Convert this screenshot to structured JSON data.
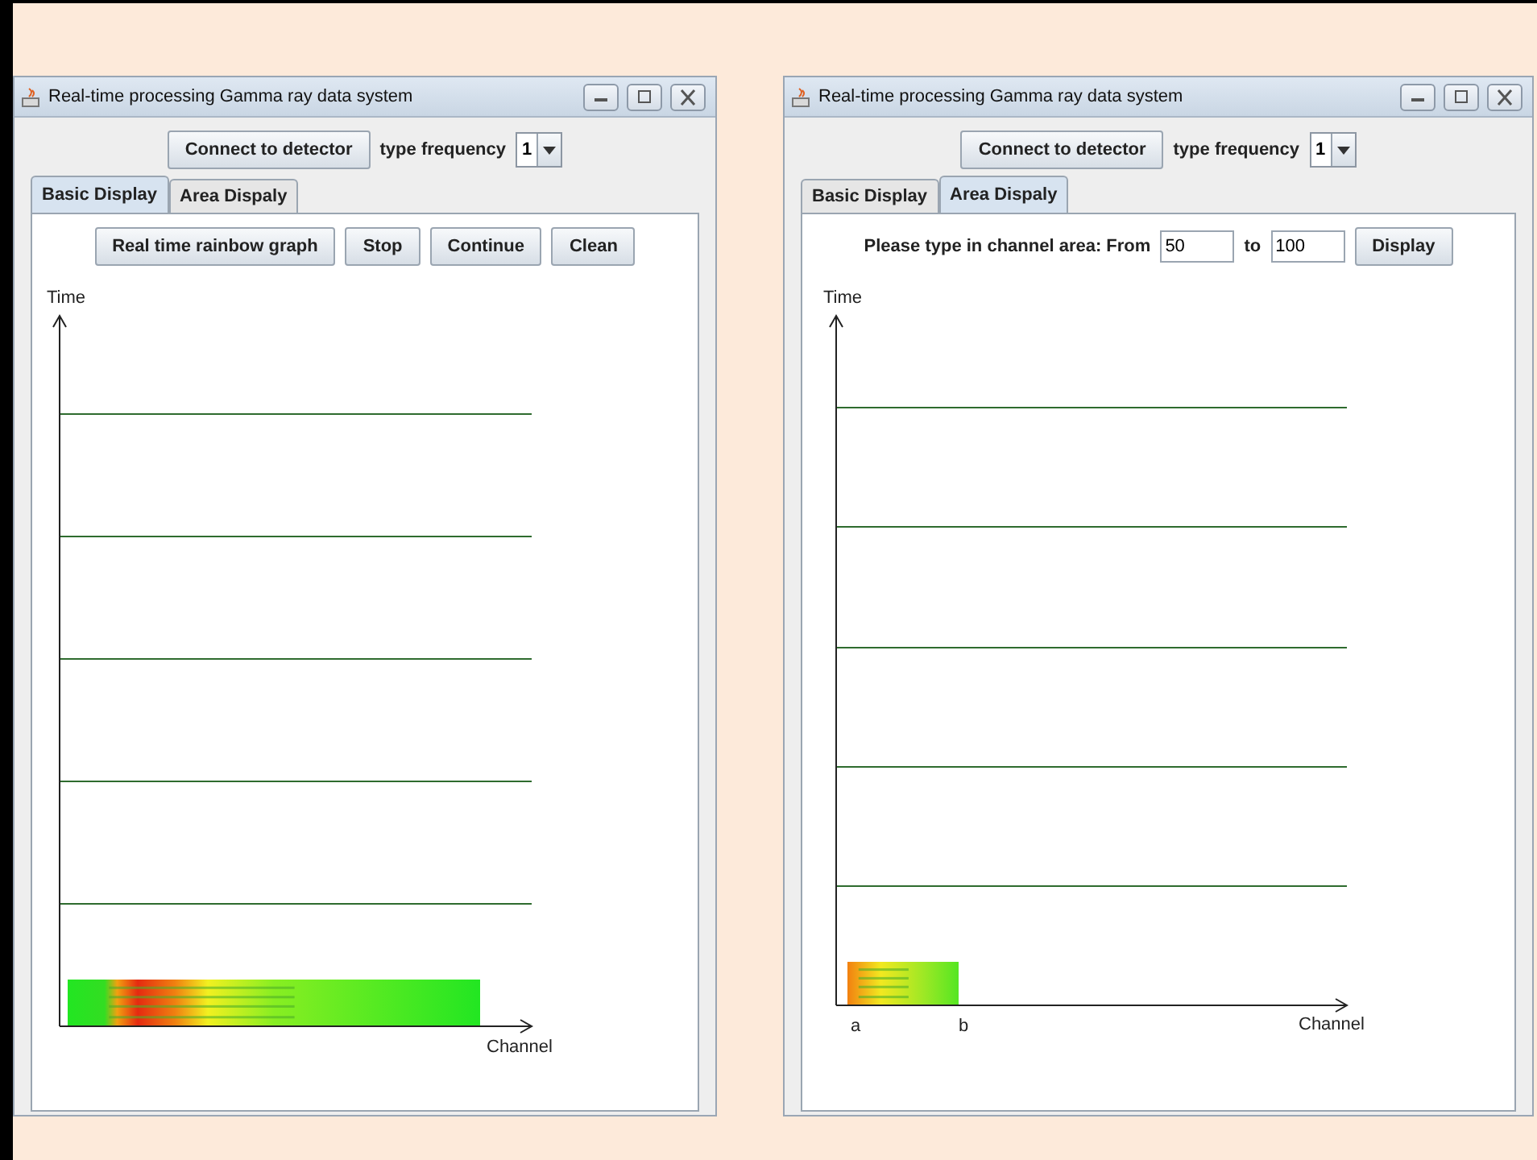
{
  "windows": [
    {
      "title": "Real-time processing Gamma ray data system",
      "connect_button": "Connect to detector",
      "frequency_label": "type frequency",
      "frequency": "1",
      "tabs": [
        {
          "label": "Basic Display",
          "selected": true
        },
        {
          "label": "Area Dispaly",
          "selected": false
        }
      ],
      "panel": {
        "kind": "buttons",
        "buttons": [
          "Real time rainbow graph",
          "Stop",
          "Continue",
          "Clean"
        ]
      },
      "plot": {
        "y_label": "Time",
        "x_label": "Channel"
      }
    },
    {
      "title": "Real-time processing Gamma ray data system",
      "connect_button": "Connect to detector",
      "frequency_label": "type frequency",
      "frequency": "1",
      "tabs": [
        {
          "label": "Basic Display",
          "selected": false
        },
        {
          "label": "Area Dispaly",
          "selected": true
        }
      ],
      "panel": {
        "kind": "area",
        "prompt": "Please type in channel area: From",
        "from": "50",
        "to_label": "to",
        "to": "100",
        "button": "Display"
      },
      "plot": {
        "y_label": "Time",
        "x_label": "Channel",
        "markers": [
          "a",
          "b"
        ]
      }
    }
  ]
}
